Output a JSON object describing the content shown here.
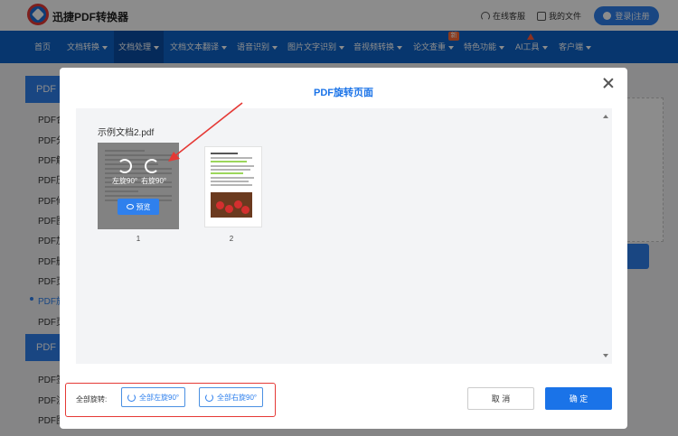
{
  "header": {
    "brand": "迅捷PDF转换器",
    "service": "在线客服",
    "files": "我的文件",
    "login": "登录|注册"
  },
  "nav": {
    "items": [
      "首页",
      "文档转换",
      "文档处理",
      "文档文本翻译",
      "语音识别",
      "图片文字识别",
      "音视频转换",
      "论文查重",
      "特色功能",
      "AI工具",
      "客户端"
    ],
    "new_badge": "新"
  },
  "sidebar": {
    "section1": "PDF处理",
    "items": [
      "PDF合并",
      "PDF分割",
      "PDF解密",
      "PDF压缩",
      "PDF修复",
      "PDF图片",
      "PDF加密",
      "PDF删除",
      "PDF页码",
      "PDF旋转",
      "PDF页面"
    ],
    "section2": "PDF编辑",
    "items2": [
      "PDF签名",
      "PDF注释",
      "PDF图片"
    ]
  },
  "modal": {
    "title": "PDF旋转页面",
    "doc_name": "示例文档2.pdf",
    "rotate_left": "左旋90°",
    "rotate_right": "右旋90°",
    "preview": "预览",
    "pages": [
      "1",
      "2"
    ],
    "footer_label": "全部旋转:",
    "all_left": "全部左旋90°",
    "all_right": "全部右旋90°",
    "cancel": "取 消",
    "confirm": "确 定"
  },
  "colors": {
    "primary": "#1a73e8",
    "nav_bg": "#0d63c9",
    "annotation_red": "#e53935"
  }
}
